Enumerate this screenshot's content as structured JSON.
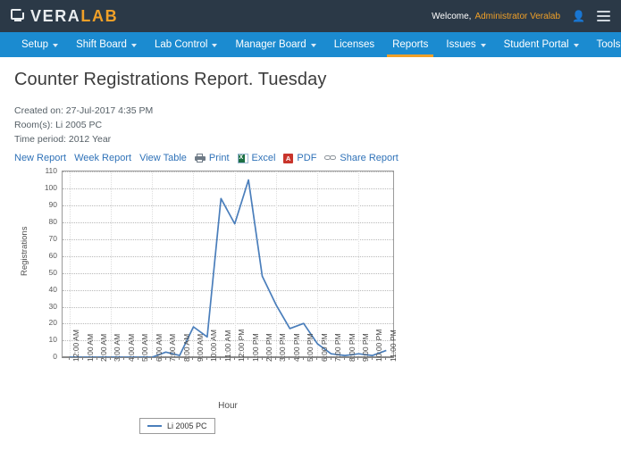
{
  "header": {
    "logo": {
      "icon": "monitor-icon",
      "text_primary": "VERA",
      "text_accent": "LAB"
    },
    "welcome_label": "Welcome,",
    "user_name": "Administrator Veralab",
    "user_icon": "user-icon",
    "menu_icon": "hamburger-menu-icon",
    "bg_color": "#2b3947",
    "accent_color": "#f0a028"
  },
  "nav": {
    "bg_color": "#1b8bd0",
    "active_underline_color": "#f0a028",
    "items": [
      {
        "label": "Setup",
        "has_caret": true,
        "active": false
      },
      {
        "label": "Shift Board",
        "has_caret": true,
        "active": false
      },
      {
        "label": "Lab Control",
        "has_caret": true,
        "active": false
      },
      {
        "label": "Manager Board",
        "has_caret": true,
        "active": false
      },
      {
        "label": "Licenses",
        "has_caret": false,
        "active": false
      },
      {
        "label": "Reports",
        "has_caret": false,
        "active": true
      },
      {
        "label": "Issues",
        "has_caret": true,
        "active": false
      },
      {
        "label": "Student Portal",
        "has_caret": true,
        "active": false
      },
      {
        "label": "Tools",
        "has_caret": true,
        "active": false
      }
    ]
  },
  "report": {
    "title": "Counter Registrations Report. Tuesday",
    "created_on": "Created on: 27-Jul-2017 4:35 PM",
    "rooms": "Room(s): Li 2005 PC",
    "time_period": "Time period: 2012 Year",
    "actions": [
      {
        "label": "New Report",
        "icon": null
      },
      {
        "label": "Week Report",
        "icon": null
      },
      {
        "label": "View Table",
        "icon": null
      },
      {
        "label": "Print",
        "icon": "printer-icon"
      },
      {
        "label": "Excel",
        "icon": "excel-file-icon"
      },
      {
        "label": "PDF",
        "icon": "pdf-file-icon"
      },
      {
        "label": "Share Report",
        "icon": "share-link-icon"
      }
    ]
  },
  "chart_data": {
    "type": "line",
    "title": "",
    "xlabel": "Hour",
    "ylabel": "Registrations",
    "ylim": [
      0,
      110
    ],
    "ytick_step": 10,
    "yticks": [
      0,
      10,
      20,
      30,
      40,
      50,
      60,
      70,
      80,
      90,
      100,
      110
    ],
    "grid": true,
    "legend_position": "bottom",
    "line_color": "#4a7ebb",
    "categories": [
      "12:00 AM",
      "1:00 AM",
      "2:00 AM",
      "3:00 AM",
      "4:00 AM",
      "5:00 AM",
      "6:00 AM",
      "7:00 AM",
      "8:00 AM",
      "9:00 AM",
      "10:00 AM",
      "11:00 AM",
      "12:00 PM",
      "1:00 PM",
      "2:00 PM",
      "3:00 PM",
      "4:00 PM",
      "5:00 PM",
      "6:00 PM",
      "7:00 PM",
      "8:00 PM",
      "9:00 PM",
      "10:00 PM",
      "11:00 PM"
    ],
    "series": [
      {
        "name": "Li 2005 PC",
        "values": [
          0,
          0,
          0,
          0,
          0,
          0,
          0,
          3,
          1,
          18,
          12,
          94,
          79,
          105,
          48,
          31,
          17,
          20,
          8,
          2,
          1,
          2,
          1,
          4
        ]
      }
    ]
  }
}
